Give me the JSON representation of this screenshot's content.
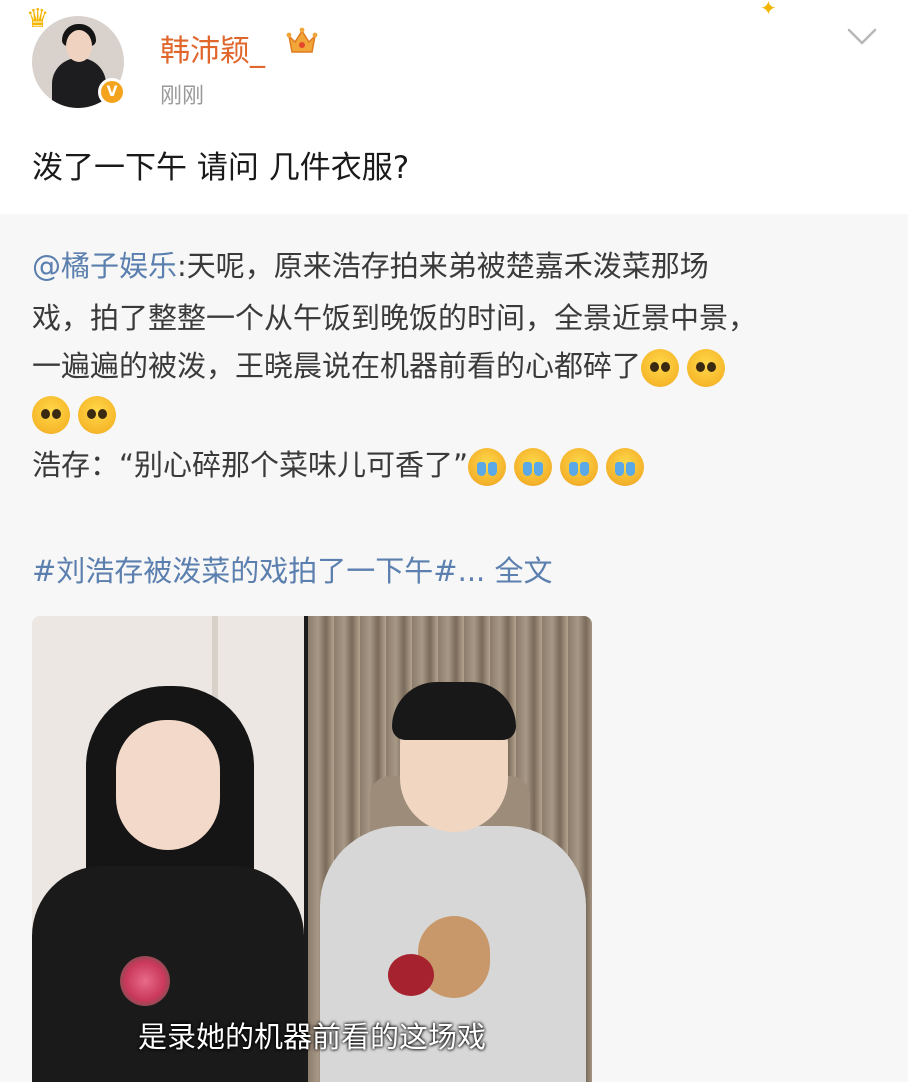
{
  "post": {
    "username": "韩沛颖_",
    "timestamp": "刚刚",
    "text": "泼了一下午 请问 几件衣服?",
    "colors": {
      "username": "#e0662b",
      "link": "#5b7fae",
      "verify_badge": "#f3a41c"
    }
  },
  "repost": {
    "mention": "@橘子娱乐",
    "line1_rest": ":天呢，原来浩存拍来弟被楚嘉禾泼菜那场",
    "line2": "戏，拍了整整一个从午饭到晚饭的时间，全景近景中景，",
    "line3": "一遍遍的被泼，王晓晨说在机器前看的心都碎了",
    "quote_line": "浩存：“别心碎那个菜味儿可香了”",
    "emoji_names": [
      "pleading-emoji",
      "crying-emoji"
    ],
    "hashtag": "#刘浩存被泼菜的戏拍了一下午#...",
    "expand_link": "全文"
  },
  "video": {
    "subtitle": "是录她的机器前看的这场戏"
  }
}
